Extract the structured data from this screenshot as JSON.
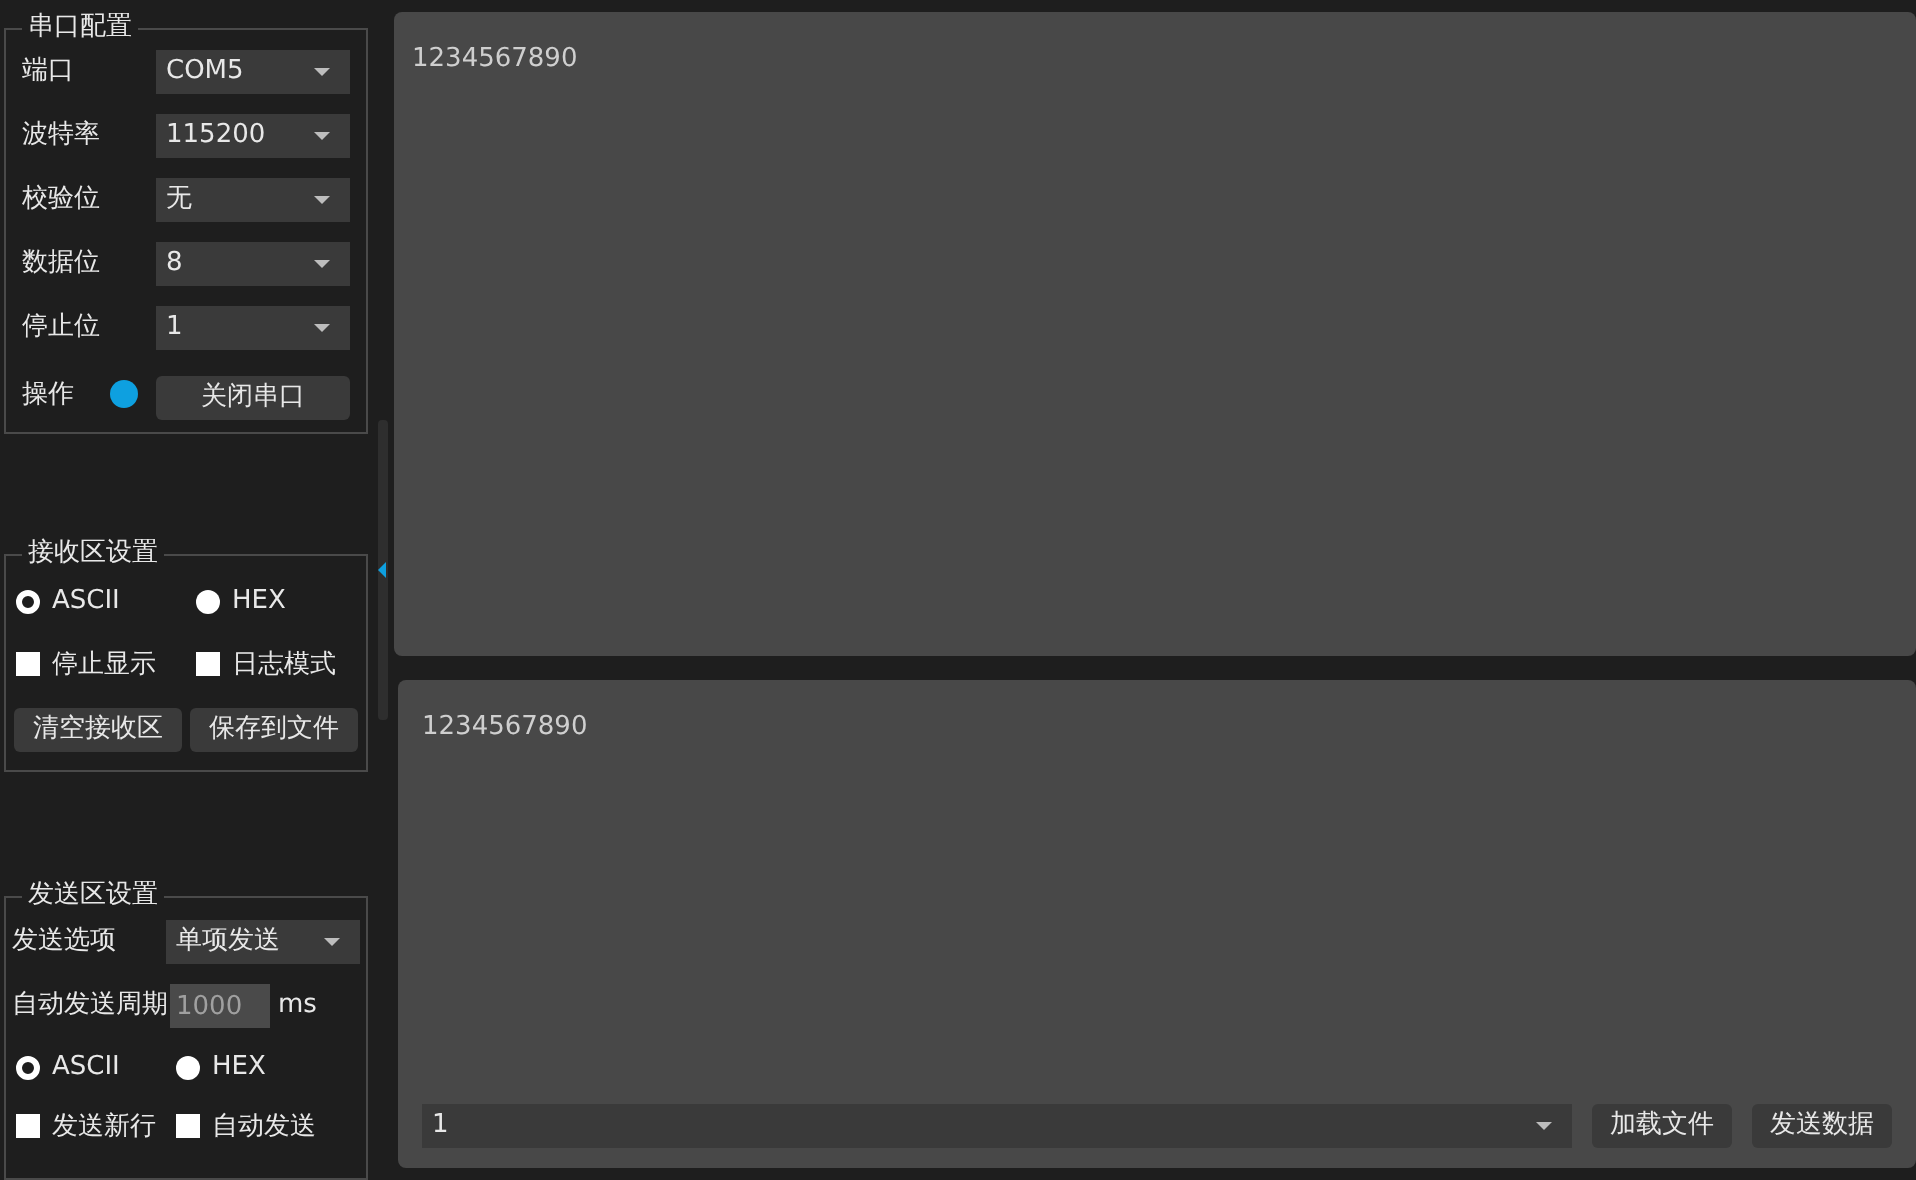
{
  "serial_config": {
    "title": "串口配置",
    "fields": [
      {
        "label": "端口",
        "value": "COM5"
      },
      {
        "label": "波特率",
        "value": "115200"
      },
      {
        "label": "校验位",
        "value": "无"
      },
      {
        "label": "数据位",
        "value": "8"
      },
      {
        "label": "停止位",
        "value": "1"
      }
    ],
    "operation": {
      "label": "操作",
      "on": true,
      "button": "关闭串口"
    }
  },
  "receive_settings": {
    "title": "接收区设置",
    "encodings": [
      {
        "label": "ASCII",
        "selected": true
      },
      {
        "label": "HEX",
        "selected": false
      }
    ],
    "options": [
      {
        "label": "停止显示",
        "checked": false
      },
      {
        "label": "日志模式",
        "checked": false
      }
    ],
    "buttons": [
      "清空接收区",
      "保存到文件"
    ]
  },
  "send_settings": {
    "title": "发送区设置",
    "send_option": {
      "label": "发送选项",
      "value": "单项发送"
    },
    "auto_period": {
      "label": "自动发送周期",
      "value": "1000",
      "unit": "ms"
    },
    "encodings": [
      {
        "label": "ASCII",
        "selected": true
      },
      {
        "label": "HEX",
        "selected": false
      }
    ],
    "options": [
      {
        "label": "发送新行",
        "checked": false
      },
      {
        "label": "自动发送",
        "checked": false
      }
    ]
  },
  "receive_area": {
    "text": "1234567890"
  },
  "send_area": {
    "text": "1234567890",
    "input": {
      "value": "1"
    },
    "buttons": [
      "加载文件",
      "发送数据"
    ]
  }
}
